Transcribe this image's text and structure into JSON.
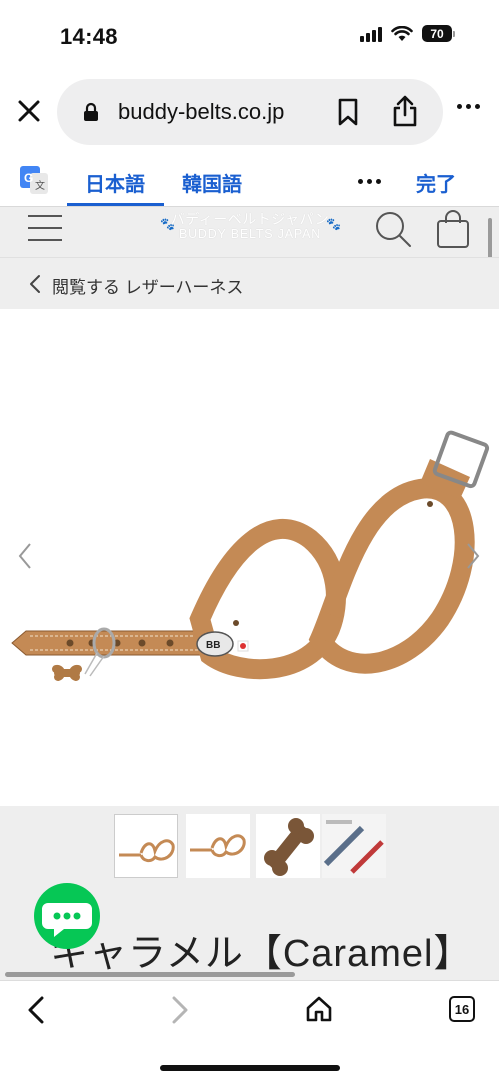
{
  "status": {
    "time": "14:48",
    "battery": "70"
  },
  "browser": {
    "url": "buddy-belts.co.jp",
    "tabs_count": "16",
    "icons": [
      "close-icon",
      "lock-icon",
      "bookmark-icon",
      "share-icon",
      "more-icon",
      "back-icon",
      "forward-icon",
      "home-icon",
      "tabs-icon"
    ]
  },
  "translate": {
    "lang_active": "日本語",
    "lang_other": "韓国語",
    "done": "完了"
  },
  "site": {
    "logo_ja": "バディーベルトジャパン",
    "logo_en": "BUDDY BELTS JAPAN",
    "breadcrumb": "閲覧する レザーハーネス"
  },
  "product": {
    "title": "キャラメル【Caramel】",
    "color_hex": "#c48a55",
    "thumbnail_count": 4,
    "selected_thumbnail": 1
  },
  "colors": {
    "accent": "#1a5fd0",
    "chat": "#06c755",
    "header_bg": "#eeeeee"
  }
}
